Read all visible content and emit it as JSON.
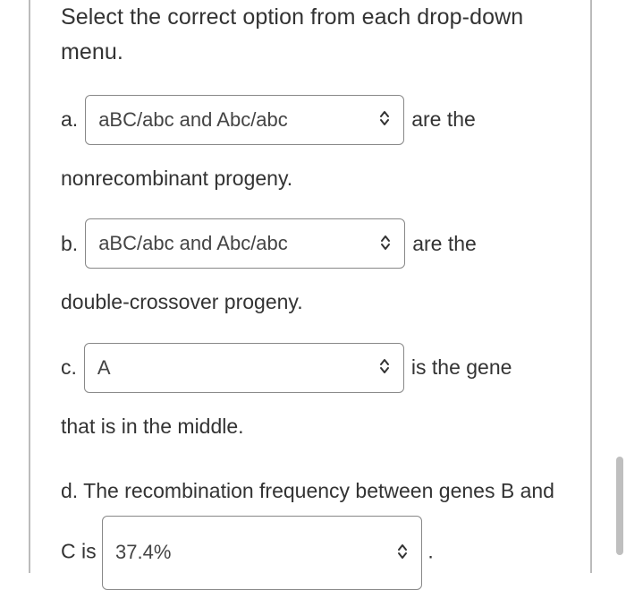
{
  "instruction": "Select the correct option from each drop-down menu.",
  "a": {
    "label": "a.",
    "selected": "aBC/abc and Abc/abc",
    "after": "are the",
    "continuation": "nonrecombinant progeny."
  },
  "b": {
    "label": "b.",
    "selected": "aBC/abc and Abc/abc",
    "after": "are the",
    "continuation": "double-crossover progeny."
  },
  "c": {
    "label": "c.",
    "selected": "A",
    "after": "is the gene",
    "continuation": "that is in the middle."
  },
  "d": {
    "text_before": "d. The recombination frequency between genes B and C is",
    "selected": "37.4%",
    "after": "."
  }
}
